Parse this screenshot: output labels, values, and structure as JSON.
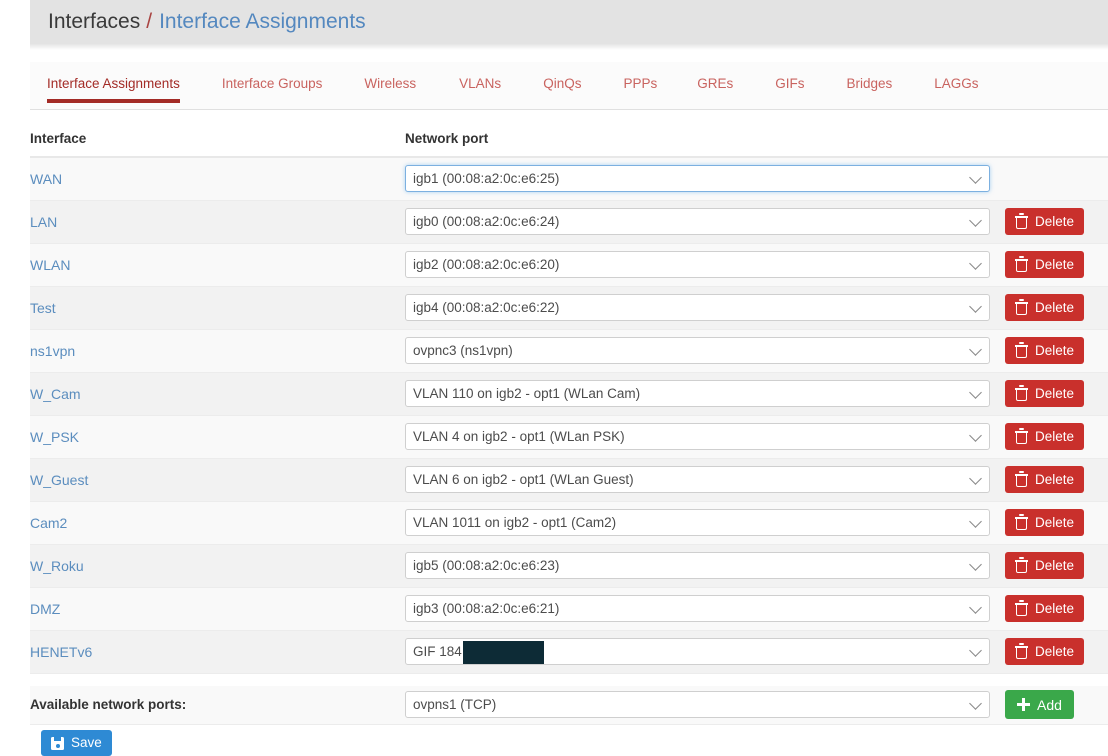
{
  "breadcrumb": {
    "root": "Interfaces",
    "separator": "/",
    "current": "Interface Assignments"
  },
  "tabs": [
    {
      "label": "Interface Assignments",
      "active": true
    },
    {
      "label": "Interface Groups",
      "active": false
    },
    {
      "label": "Wireless",
      "active": false
    },
    {
      "label": "VLANs",
      "active": false
    },
    {
      "label": "QinQs",
      "active": false
    },
    {
      "label": "PPPs",
      "active": false
    },
    {
      "label": "GREs",
      "active": false
    },
    {
      "label": "GIFs",
      "active": false
    },
    {
      "label": "Bridges",
      "active": false
    },
    {
      "label": "LAGGs",
      "active": false
    }
  ],
  "table": {
    "headers": {
      "interface": "Interface",
      "network_port": "Network port"
    },
    "rows": [
      {
        "interface": "WAN",
        "port": "igb1 (00:08:a2:0c:e6:25)",
        "delete": false,
        "focused": true,
        "redacted": false
      },
      {
        "interface": "LAN",
        "port": "igb0 (00:08:a2:0c:e6:24)",
        "delete": true,
        "focused": false,
        "redacted": false
      },
      {
        "interface": "WLAN",
        "port": "igb2 (00:08:a2:0c:e6:20)",
        "delete": true,
        "focused": false,
        "redacted": false
      },
      {
        "interface": "Test",
        "port": "igb4 (00:08:a2:0c:e6:22)",
        "delete": true,
        "focused": false,
        "redacted": false
      },
      {
        "interface": "ns1vpn",
        "port": "ovpnc3 (ns1vpn)",
        "delete": true,
        "focused": false,
        "redacted": false
      },
      {
        "interface": "W_Cam",
        "port": "VLAN 110 on igb2 - opt1 (WLan Cam)",
        "delete": true,
        "focused": false,
        "redacted": false
      },
      {
        "interface": "W_PSK",
        "port": "VLAN 4 on igb2 - opt1 (WLan PSK)",
        "delete": true,
        "focused": false,
        "redacted": false
      },
      {
        "interface": "W_Guest",
        "port": "VLAN 6 on igb2 - opt1 (WLan Guest)",
        "delete": true,
        "focused": false,
        "redacted": false
      },
      {
        "interface": "Cam2",
        "port": "VLAN 1011 on igb2 - opt1 (Cam2)",
        "delete": true,
        "focused": false,
        "redacted": false
      },
      {
        "interface": "W_Roku",
        "port": "igb5 (00:08:a2:0c:e6:23)",
        "delete": true,
        "focused": false,
        "redacted": false
      },
      {
        "interface": "DMZ",
        "port": "igb3 (00:08:a2:0c:e6:21)",
        "delete": true,
        "focused": false,
        "redacted": false
      },
      {
        "interface": "HENETv6",
        "port": "GIF 184.                 HE)",
        "delete": true,
        "focused": false,
        "redacted": true
      }
    ]
  },
  "available": {
    "label": "Available network ports:",
    "port": "ovpns1 (TCP)",
    "add_label": "Add"
  },
  "buttons": {
    "delete_label": "Delete",
    "save_label": "Save"
  },
  "colors": {
    "accent_red": "#a32b26",
    "link_blue": "#5b8dbe",
    "delete_red": "#c9302c",
    "add_green": "#3aa84a",
    "save_blue": "#2e8ad4",
    "redaction": "#0d2b36"
  }
}
